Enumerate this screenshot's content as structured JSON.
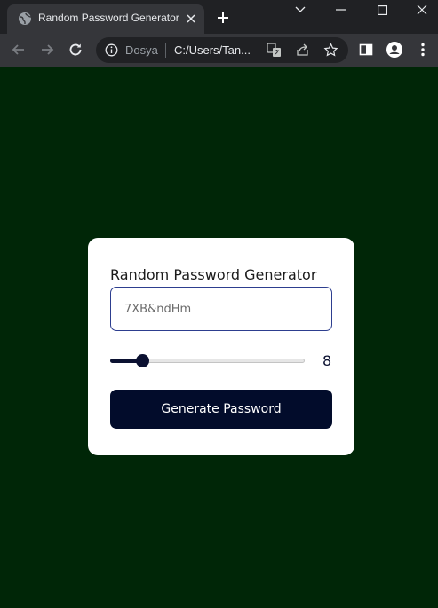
{
  "browser": {
    "tab": {
      "title": "Random Password Generator"
    },
    "address_bar": {
      "site_label": "Dosya",
      "url": "C:/Users/Tan..."
    }
  },
  "app": {
    "title": "Random Password Generator",
    "password_field": {
      "value": "7XB&ndHm"
    },
    "length_slider": {
      "value": 8,
      "min": 4,
      "max": 32
    },
    "generate_button_label": "Generate Password"
  },
  "colors": {
    "page_background": "#002607",
    "card_background": "#ffffff",
    "accent": "#0b1131",
    "button_background": "#020c2b",
    "input_border": "#2d3e8f"
  },
  "icons": [
    "globe-icon",
    "close-icon",
    "plus-icon",
    "chevron-down-icon",
    "minimize-icon",
    "maximize-icon",
    "window-close-icon",
    "back-arrow-icon",
    "forward-arrow-icon",
    "reload-icon",
    "info-icon",
    "translate-icon",
    "share-icon",
    "star-icon",
    "side-panel-icon",
    "profile-icon",
    "more-vert-icon"
  ]
}
